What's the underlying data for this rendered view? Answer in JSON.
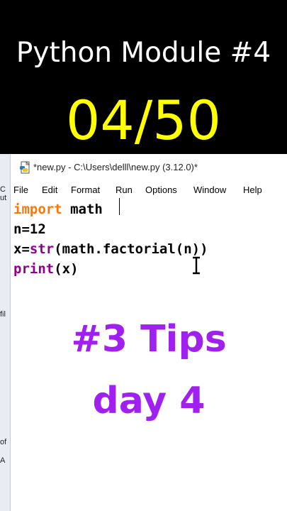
{
  "banner": {
    "headline": "Python Module #4",
    "counter": "04/50",
    "headline_color": "#ffffff",
    "counter_color": "#ffff00"
  },
  "left_strip": {
    "fragments": [
      "C",
      "ut",
      "fil",
      "of",
      "A"
    ]
  },
  "editor": {
    "title": "*new.py - C:\\Users\\delll\\new.py (3.12.0)*",
    "icon": "python-file-icon",
    "menu": [
      "File",
      "Edit",
      "Format",
      "Run",
      "Options",
      "Window",
      "Help"
    ],
    "code": {
      "line1": {
        "keyword": "import",
        "rest": " math"
      },
      "line2": {
        "text": "n=12"
      },
      "line3": {
        "prefix": "x=",
        "builtin": "str",
        "rest": "(math.factorial(n))"
      },
      "line4": {
        "builtin": "print",
        "rest": "(x)"
      }
    },
    "syntax_colors": {
      "keyword": "#ff7700",
      "builtin": "#900090"
    }
  },
  "overlay": {
    "tip_title": "#3 Tips",
    "tip_day": "day 4",
    "color": "#a020f0"
  }
}
